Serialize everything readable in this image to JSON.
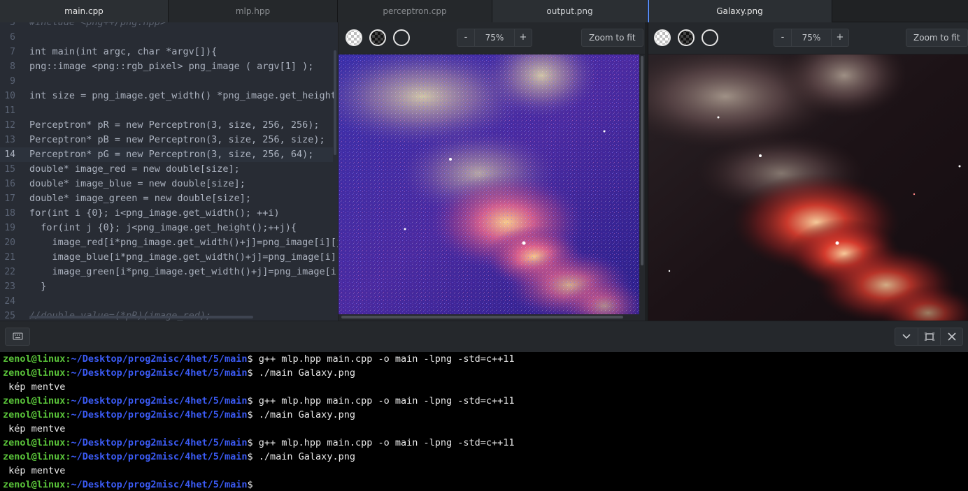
{
  "tabs": [
    {
      "label": "main.cpp"
    },
    {
      "label": "mlp.hpp"
    },
    {
      "label": "perceptron.cpp"
    },
    {
      "label": "output.png"
    },
    {
      "label": "Galaxy.png"
    }
  ],
  "editor": {
    "lines": [
      {
        "num": "5",
        "text": "#include <png++/png.hpp>"
      },
      {
        "num": "6",
        "text": ""
      },
      {
        "num": "7",
        "text": "int main(int argc, char *argv[]){"
      },
      {
        "num": "8",
        "text": "png::image <png::rgb_pixel> png_image ( argv[1] );"
      },
      {
        "num": "9",
        "text": ""
      },
      {
        "num": "10",
        "text": "int size = png_image.get_width() *png_image.get_height();"
      },
      {
        "num": "11",
        "text": ""
      },
      {
        "num": "12",
        "text": "Perceptron* pR = new Perceptron(3, size, 256, 256);"
      },
      {
        "num": "13",
        "text": "Perceptron* pB = new Perceptron(3, size, 256, size);"
      },
      {
        "num": "14",
        "text": "Perceptron* pG = new Perceptron(3, size, 256, 64);"
      },
      {
        "num": "15",
        "text": "double* image_red = new double[size];"
      },
      {
        "num": "16",
        "text": "double* image_blue = new double[size];"
      },
      {
        "num": "17",
        "text": "double* image_green = new double[size];"
      },
      {
        "num": "18",
        "text": "for(int i {0}; i<png_image.get_width(); ++i)"
      },
      {
        "num": "19",
        "text": "  for(int j {0}; j<png_image.get_height();++j){"
      },
      {
        "num": "20",
        "text": "    image_red[i*png_image.get_width()+j]=png_image[i][j].red;"
      },
      {
        "num": "21",
        "text": "    image_blue[i*png_image.get_width()+j]=png_image[i][j].blue;"
      },
      {
        "num": "22",
        "text": "    image_green[i*png_image.get_width()+j]=png_image[i][j].green;"
      },
      {
        "num": "23",
        "text": "  }"
      },
      {
        "num": "24",
        "text": ""
      },
      {
        "num": "25",
        "text": "//double value=(*pR)(image_red);"
      }
    ]
  },
  "viewer_left": {
    "zoom": "75%",
    "minus": "-",
    "plus": "+",
    "fit": "Zoom to fit"
  },
  "viewer_right": {
    "zoom": "75%",
    "minus": "-",
    "plus": "+",
    "fit": "Zoom to fit"
  },
  "icons": {
    "bg_light": "checker-light-icon",
    "bg_dark": "checker-dark-icon",
    "bg_none": "transparent-bg-icon",
    "keyboard": "keyboard-icon",
    "collapse": "chevron-down-icon",
    "maximize": "maximize-icon",
    "close": "close-icon"
  },
  "terminal": {
    "user": "zenol@linux",
    "path": "~/Desktop/prog2misc/4het/5/main",
    "lines": [
      {
        "type": "cmd",
        "cmd": "g++ mlp.hpp main.cpp -o main -lpng -std=c++11"
      },
      {
        "type": "cmd",
        "cmd": "./main Galaxy.png"
      },
      {
        "type": "out",
        "text": " kép mentve"
      },
      {
        "type": "cmd",
        "cmd": "g++ mlp.hpp main.cpp -o main -lpng -std=c++11"
      },
      {
        "type": "cmd",
        "cmd": "./main Galaxy.png"
      },
      {
        "type": "out",
        "text": " kép mentve"
      },
      {
        "type": "cmd",
        "cmd": "g++ mlp.hpp main.cpp -o main -lpng -std=c++11"
      },
      {
        "type": "cmd",
        "cmd": "./main Galaxy.png"
      },
      {
        "type": "out",
        "text": " kép mentve"
      },
      {
        "type": "cmd",
        "cmd": ""
      }
    ]
  },
  "colors": {
    "accent": "#568af2",
    "terminal_user": "#5ac43a",
    "terminal_path": "#3b5bf5"
  }
}
